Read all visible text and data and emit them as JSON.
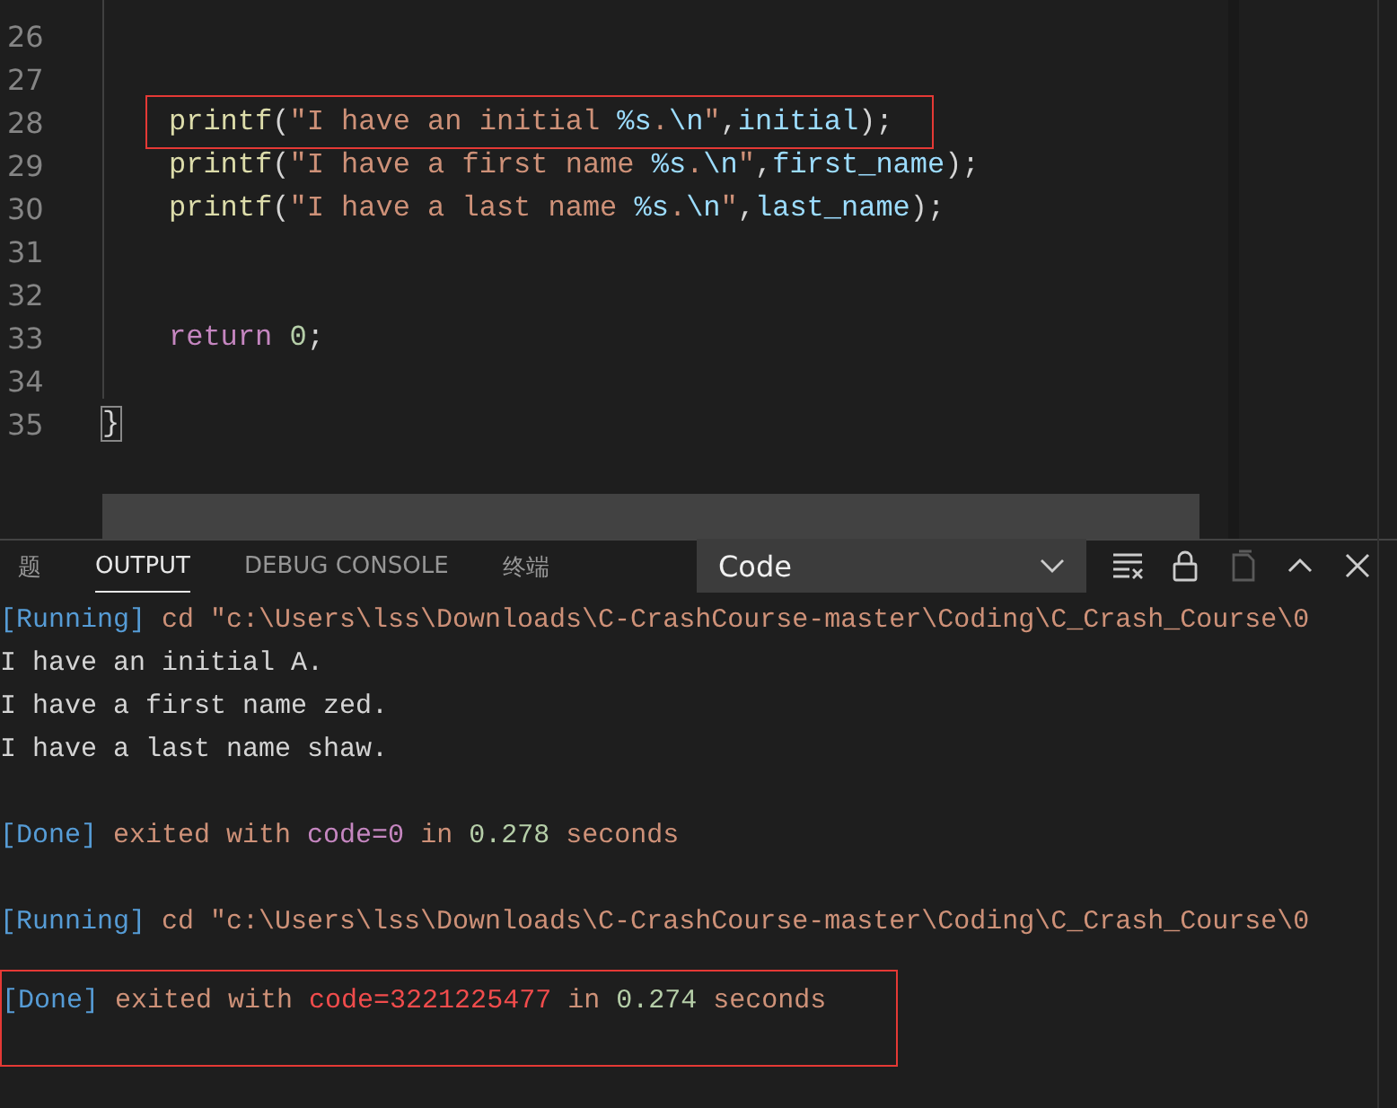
{
  "editor": {
    "lines": [
      {
        "number": "26",
        "highlighted": false
      },
      {
        "number": "27",
        "highlighted": false
      },
      {
        "number": "28",
        "highlighted": true,
        "tokens": [
          {
            "kind": "function",
            "text": "printf"
          },
          {
            "kind": "punct",
            "text": "("
          },
          {
            "kind": "string",
            "text": "\"I have an initial "
          },
          {
            "kind": "format",
            "text": "%s"
          },
          {
            "kind": "string",
            "text": "."
          },
          {
            "kind": "format",
            "text": "\\n"
          },
          {
            "kind": "string",
            "text": "\""
          },
          {
            "kind": "punct",
            "text": ","
          },
          {
            "kind": "variable",
            "text": "initial"
          },
          {
            "kind": "punct",
            "text": ");"
          }
        ]
      },
      {
        "number": "29",
        "highlighted": false,
        "tokens": [
          {
            "kind": "function",
            "text": "printf"
          },
          {
            "kind": "punct",
            "text": "("
          },
          {
            "kind": "string",
            "text": "\"I have a first name "
          },
          {
            "kind": "format",
            "text": "%s"
          },
          {
            "kind": "string",
            "text": "."
          },
          {
            "kind": "format",
            "text": "\\n"
          },
          {
            "kind": "string",
            "text": "\""
          },
          {
            "kind": "punct",
            "text": ","
          },
          {
            "kind": "variable",
            "text": "first_name"
          },
          {
            "kind": "punct",
            "text": ");"
          }
        ]
      },
      {
        "number": "30",
        "highlighted": false,
        "tokens": [
          {
            "kind": "function",
            "text": "printf"
          },
          {
            "kind": "punct",
            "text": "("
          },
          {
            "kind": "string",
            "text": "\"I have a last name "
          },
          {
            "kind": "format",
            "text": "%s"
          },
          {
            "kind": "string",
            "text": "."
          },
          {
            "kind": "format",
            "text": "\\n"
          },
          {
            "kind": "string",
            "text": "\""
          },
          {
            "kind": "punct",
            "text": ","
          },
          {
            "kind": "variable",
            "text": "last_name"
          },
          {
            "kind": "punct",
            "text": ");"
          }
        ]
      },
      {
        "number": "31",
        "highlighted": false
      },
      {
        "number": "32",
        "highlighted": false
      },
      {
        "number": "33",
        "highlighted": false,
        "tokens": [
          {
            "kind": "keyword",
            "text": "return"
          },
          {
            "kind": "number",
            "text": "0"
          },
          {
            "kind": "punct",
            "text": ";"
          }
        ]
      },
      {
        "number": "34",
        "highlighted": false
      },
      {
        "number": "35",
        "highlighted": false,
        "tokens": [
          {
            "kind": "brace-match",
            "text": "}"
          }
        ]
      }
    ]
  },
  "panel": {
    "tabs": [
      {
        "label": "题",
        "selected": false
      },
      {
        "label": "OUTPUT",
        "selected": true
      },
      {
        "label": "DEBUG CONSOLE",
        "selected": false
      },
      {
        "label": "终端",
        "selected": false
      }
    ],
    "channel": {
      "value": "Code"
    },
    "output": [
      {
        "highlighted": false,
        "segments": [
          {
            "kind": "tag",
            "text": "[Running]"
          },
          {
            "kind": "text",
            "text": " cd \"c:\\Users\\lss\\Downloads\\C-CrashCourse-master\\Coding\\C_Crash_Course\\0"
          }
        ]
      },
      {
        "highlighted": false,
        "segments": [
          {
            "kind": "plain",
            "text": "I have an initial A."
          }
        ]
      },
      {
        "highlighted": false,
        "segments": [
          {
            "kind": "plain",
            "text": "I have a first name zed."
          }
        ]
      },
      {
        "highlighted": false,
        "segments": [
          {
            "kind": "plain",
            "text": "I have a last name shaw."
          }
        ]
      },
      {
        "highlighted": false
      },
      {
        "highlighted": false,
        "segments": [
          {
            "kind": "tag",
            "text": "[Done]"
          },
          {
            "kind": "text",
            "text": " exited with "
          },
          {
            "kind": "code-ok",
            "text": "code=0"
          },
          {
            "kind": "text",
            "text": " in "
          },
          {
            "kind": "number",
            "text": "0.278"
          },
          {
            "kind": "text",
            "text": " seconds"
          }
        ]
      },
      {
        "highlighted": false
      },
      {
        "highlighted": false,
        "segments": [
          {
            "kind": "tag",
            "text": "[Running]"
          },
          {
            "kind": "text",
            "text": " cd \"c:\\Users\\lss\\Downloads\\C-CrashCourse-master\\Coding\\C_Crash_Course\\0"
          }
        ]
      },
      {
        "highlighted": false
      },
      {
        "highlighted": true,
        "segments": [
          {
            "kind": "tag",
            "text": "[Done]"
          },
          {
            "kind": "text",
            "text": " exited with "
          },
          {
            "kind": "code-error",
            "text": "code=3221225477"
          },
          {
            "kind": "text",
            "text": " in "
          },
          {
            "kind": "number",
            "text": "0.274"
          },
          {
            "kind": "text",
            "text": " seconds"
          }
        ]
      }
    ]
  }
}
